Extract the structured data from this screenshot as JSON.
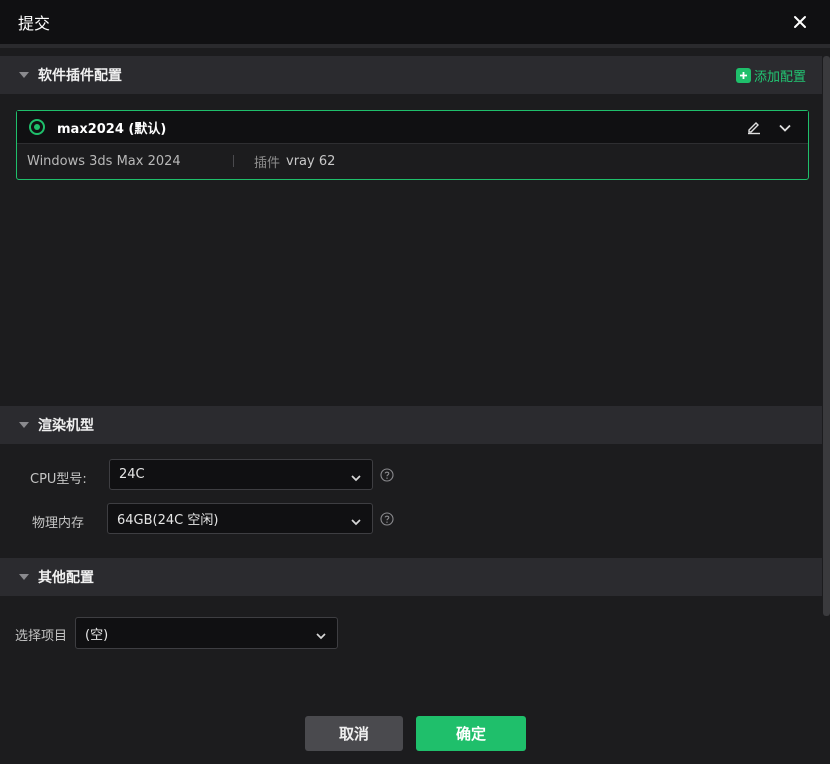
{
  "dialog": {
    "title": "提交"
  },
  "sections": {
    "software": {
      "title": "软件插件配置",
      "add_label": "添加配置"
    },
    "render": {
      "title": "渲染机型"
    },
    "other": {
      "title": "其他配置"
    }
  },
  "plugin_config": {
    "name": "max2024 (默认)",
    "software": "Windows 3ds Max 2024",
    "plugin_label": "插件",
    "plugin_value": "vray 62",
    "selected": true
  },
  "render_machine": {
    "cpu": {
      "label": "CPU型号:",
      "value": "24C"
    },
    "memory": {
      "label": "物理内存",
      "value": "64GB(24C 空闲)"
    }
  },
  "other_config": {
    "project": {
      "label": "选择项目",
      "value": "(空)"
    }
  },
  "buttons": {
    "cancel": "取消",
    "ok": "确定"
  },
  "colors": {
    "accent": "#1fbf6b",
    "background": "#1c1c1e",
    "header": "#2b2b2f"
  }
}
